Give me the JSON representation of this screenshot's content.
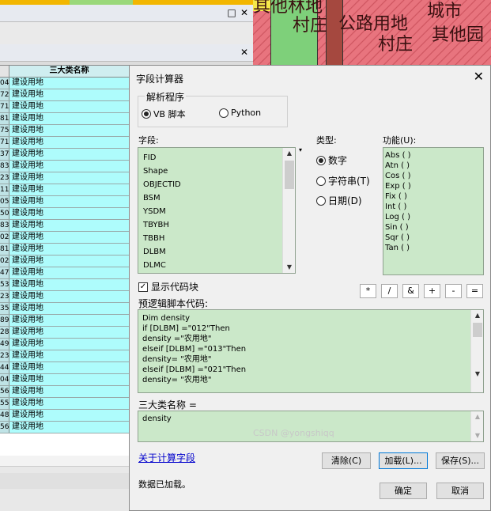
{
  "background": {
    "table": {
      "header": "三大类名称",
      "row_ids": [
        "04",
        "72",
        "71",
        "81",
        "75",
        "71",
        "37",
        "83",
        "23",
        "11",
        "05",
        "50",
        "83",
        "02",
        "81",
        "02",
        "47",
        "53",
        "23",
        "35",
        "89",
        "28",
        "49",
        "23",
        "44",
        "04",
        "56",
        "55",
        "48",
        "56"
      ],
      "cell_value": "建设用地"
    },
    "map_labels": [
      "其他林地",
      "村庄",
      "公路用地",
      "村庄",
      "城市",
      "其他园"
    ]
  },
  "dialog": {
    "title": "字段计算器",
    "parser": {
      "label": "解析程序",
      "options": [
        "VB 脚本",
        "Python"
      ],
      "selected": "VB 脚本"
    },
    "fields": {
      "label": "字段:",
      "items": [
        "FID",
        "Shape",
        "OBJECTID",
        "BSM",
        "YSDM",
        "TBYBH",
        "TBBH",
        "DLBM",
        "DLMC"
      ]
    },
    "type": {
      "label": "类型:",
      "options": [
        "数字",
        "字符串(T)",
        "日期(D)"
      ],
      "selected": "数字"
    },
    "functions": {
      "label": "功能(U):",
      "items": [
        "Abs ( )",
        "Atn ( )",
        "Cos ( )",
        "Exp ( )",
        "Fix ( )",
        "Int ( )",
        "Log ( )",
        "Sin ( )",
        "Sqr ( )",
        "Tan ( )"
      ]
    },
    "show_codeblock": {
      "label": "显示代码块",
      "checked": true
    },
    "operators": [
      "*",
      "/",
      "&",
      "+",
      "-",
      "="
    ],
    "prelogic": {
      "label": "预逻辑脚本代码:",
      "lines": [
        "Dim density",
        "if [DLBM] =\"012\"Then",
        "density =\"农用地\"",
        "elseif [DLBM] =\"013\"Then",
        "density= \"农用地\"",
        "elseif [DLBM] =\"021\"Then",
        "density= \"农用地\""
      ]
    },
    "expression": {
      "label": "三大类名称 =",
      "value": "density"
    },
    "about_link": "关于计算字段",
    "buttons": {
      "clear": "清除(C)",
      "load": "加载(L)...",
      "save": "保存(S)...",
      "ok": "确定",
      "cancel": "取消"
    },
    "status": "数据已加载。"
  },
  "watermark": "CSDN @yongshiqq"
}
